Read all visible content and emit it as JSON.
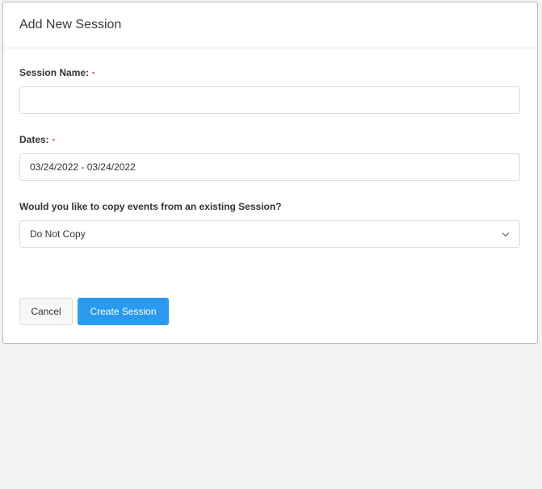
{
  "modal": {
    "title": "Add New Session",
    "fields": {
      "session_name": {
        "label": "Session Name:",
        "required_mark": "•",
        "value": "",
        "placeholder": ""
      },
      "dates": {
        "label": "Dates:",
        "required_mark": "•",
        "value": "03/24/2022 - 03/24/2022"
      },
      "copy_events": {
        "label": "Would you like to copy events from an existing Session?",
        "selected": "Do Not Copy"
      }
    },
    "buttons": {
      "cancel_label": "Cancel",
      "create_label": "Create Session"
    }
  },
  "colors": {
    "primary": "#2a9af0",
    "required": "#e0544a",
    "background": "#f3f3f3"
  },
  "icons": {
    "select_indicator": "chevron-down-icon"
  }
}
